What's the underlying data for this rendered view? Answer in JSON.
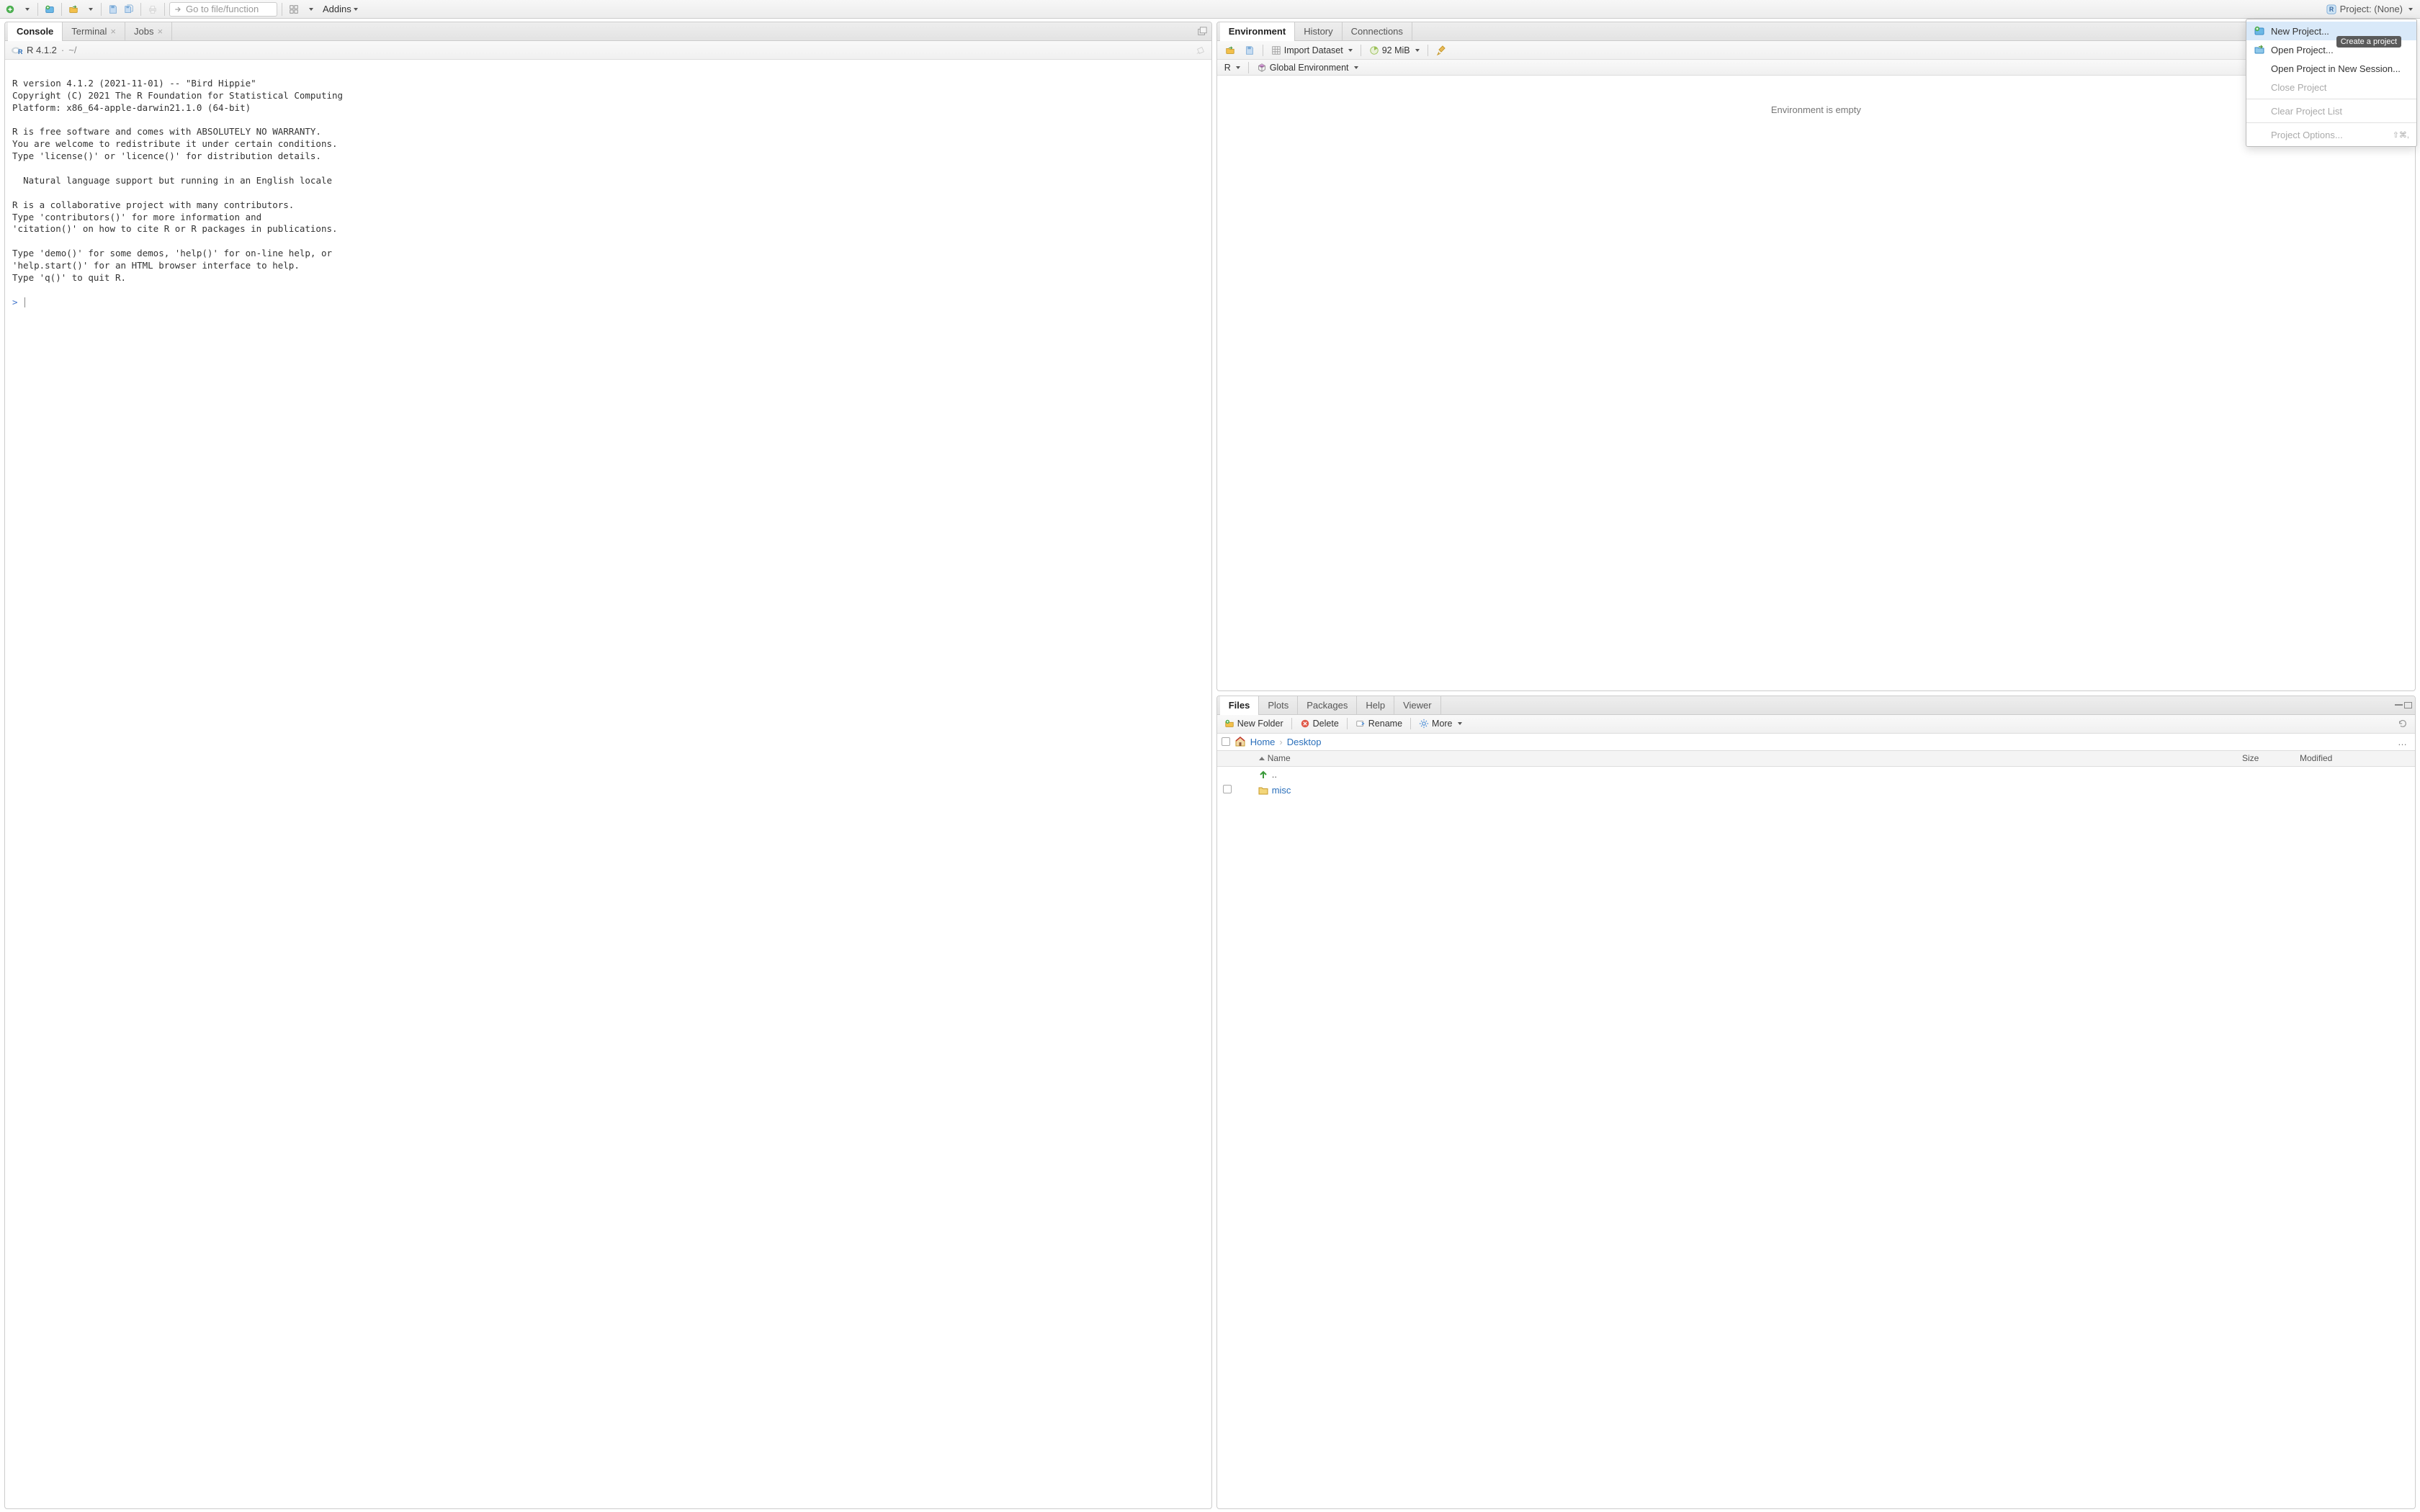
{
  "toolbar": {
    "goto_placeholder": "Go to file/function",
    "addins_label": "Addins"
  },
  "project": {
    "label": "Project: (None)",
    "menu": {
      "new": "New Project...",
      "open": "Open Project...",
      "open_new_session": "Open Project in New Session...",
      "close": "Close Project",
      "clear": "Clear Project List",
      "options": "Project Options...",
      "options_shortcut": "⇧⌘,"
    },
    "tooltip": "Create a project"
  },
  "left_tabs": {
    "console": "Console",
    "terminal": "Terminal",
    "jobs": "Jobs"
  },
  "console": {
    "version": "R 4.1.2",
    "path_sep": "·",
    "path": "~/",
    "body": "\nR version 4.1.2 (2021-11-01) -- \"Bird Hippie\"\nCopyright (C) 2021 The R Foundation for Statistical Computing\nPlatform: x86_64-apple-darwin21.1.0 (64-bit)\n\nR is free software and comes with ABSOLUTELY NO WARRANTY.\nYou are welcome to redistribute it under certain conditions.\nType 'license()' or 'licence()' for distribution details.\n\n  Natural language support but running in an English locale\n\nR is a collaborative project with many contributors.\nType 'contributors()' for more information and\n'citation()' on how to cite R or R packages in publications.\n\nType 'demo()' for some demos, 'help()' for on-line help, or\n'help.start()' for an HTML browser interface to help.\nType 'q()' to quit R.\n\n",
    "prompt": "> "
  },
  "env_tabs": {
    "environment": "Environment",
    "history": "History",
    "connections": "Connections"
  },
  "env_toolbar": {
    "import": "Import Dataset",
    "mem": "92 MiB",
    "scope_label": "R",
    "global_env": "Global Environment"
  },
  "env_body": {
    "empty": "Environment is empty"
  },
  "files_tabs": {
    "files": "Files",
    "plots": "Plots",
    "packages": "Packages",
    "help": "Help",
    "viewer": "Viewer"
  },
  "files_toolbar": {
    "new_folder": "New Folder",
    "delete": "Delete",
    "rename": "Rename",
    "more": "More"
  },
  "breadcrumb": {
    "home": "Home",
    "desktop": "Desktop"
  },
  "file_cols": {
    "name": "Name",
    "size": "Size",
    "modified": "Modified"
  },
  "files": {
    "up": "..",
    "items": [
      {
        "name": "misc",
        "type": "folder"
      }
    ]
  }
}
